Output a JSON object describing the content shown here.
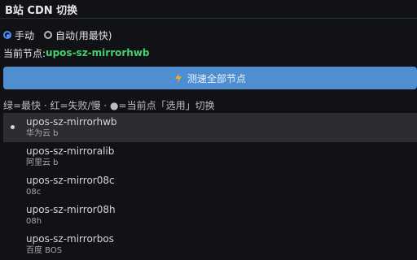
{
  "header": {
    "title": "B站 CDN 切换"
  },
  "mode": {
    "options": [
      {
        "label": "手动",
        "checked": true
      },
      {
        "label": "自动(用最快)",
        "checked": false
      }
    ]
  },
  "current": {
    "label": "当前节点:",
    "value": "upos-sz-mirrorhwb"
  },
  "actions": {
    "speedtest_label": "测速全部节点"
  },
  "legend": {
    "text": "绿=最快 · 红=失败/慢 · ●=当前点「选用」切换"
  },
  "nodes": [
    {
      "name": "upos-sz-mirrorhwb",
      "sub": "华为云 b",
      "active": true
    },
    {
      "name": "upos-sz-mirroralib",
      "sub": "阿里云 b",
      "active": false
    },
    {
      "name": "upos-sz-mirror08c",
      "sub": "08c",
      "active": false
    },
    {
      "name": "upos-sz-mirror08h",
      "sub": "08h",
      "active": false
    },
    {
      "name": "upos-sz-mirrorbos",
      "sub": "百度 BOS",
      "active": false
    }
  ],
  "colors": {
    "background": "#111215",
    "accent": "#4f8fcf",
    "current_value": "#45d06e",
    "active_row": "#2b2d32"
  }
}
